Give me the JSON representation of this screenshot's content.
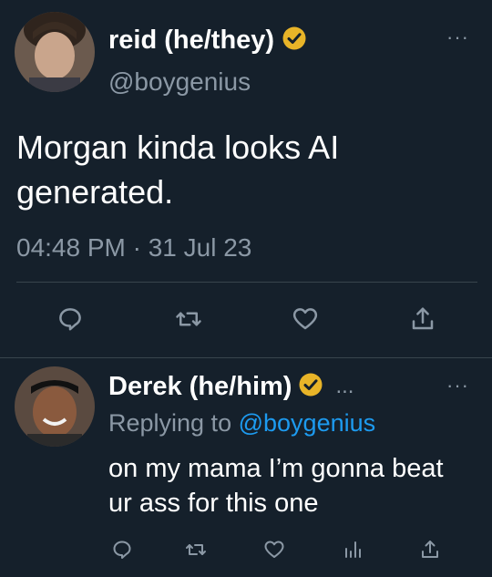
{
  "main_tweet": {
    "display_name": "reid (he/they)",
    "handle": "@boygenius",
    "text": "Morgan kinda looks AI generated.",
    "timestamp": "04:48 PM · 31 Jul 23",
    "avatar": "person-photo-icon",
    "verified_badge": "gold-verified-icon",
    "more": "···"
  },
  "actions": [
    "reply-icon",
    "retweet-icon",
    "like-icon",
    "share-icon"
  ],
  "reply_tweet": {
    "display_name": "Derek (he/him)",
    "ellipsis": "...",
    "replying_prefix": "Replying to",
    "replying_handle": "@boygenius",
    "text": "on my mama I’m gonna beat ur ass for this one",
    "avatar": "person-photo-icon",
    "verified_badge": "gold-verified-icon",
    "more": "···"
  },
  "reply_actions": [
    "reply-icon",
    "retweet-icon",
    "like-icon",
    "views-icon",
    "share-icon"
  ],
  "colors": {
    "background": "#15202b",
    "text": "#ffffff",
    "muted": "#8b98a5",
    "link": "#1d9bf0",
    "verified": "#e8b428",
    "divider": "#38444d"
  }
}
